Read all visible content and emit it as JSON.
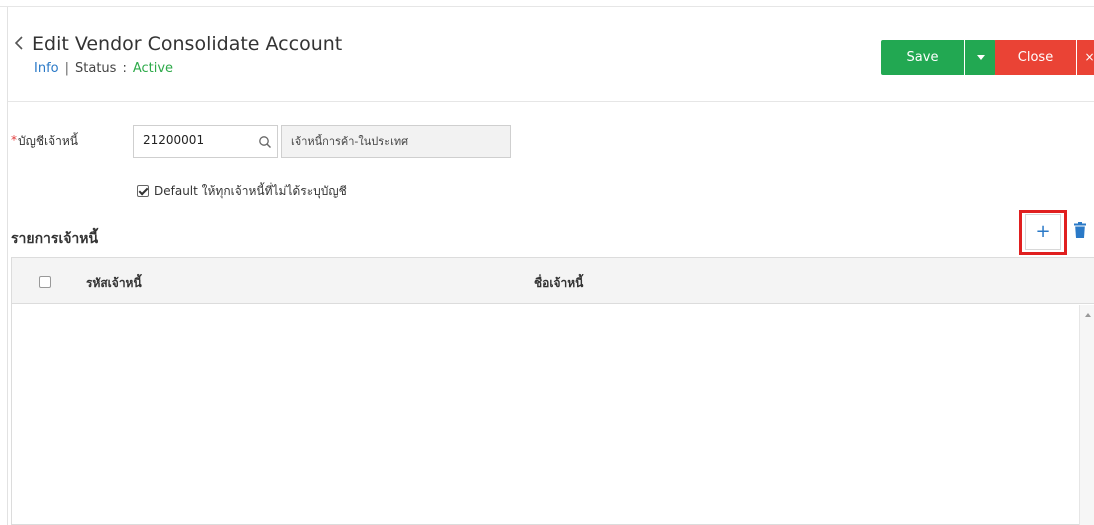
{
  "header": {
    "title": "Edit Vendor Consolidate Account",
    "info_link": "Info",
    "separator": "|",
    "status_label": "Status",
    "status_colon": ":",
    "status_value": "Active"
  },
  "toolbar": {
    "save_label": "Save",
    "close_label": "Close",
    "close_x": "×"
  },
  "form": {
    "required_mark": "*",
    "account_label": "บัญชีเจ้าหนี้",
    "account_code": "21200001",
    "account_name": "เจ้าหนี้การค้า-ในประเทศ",
    "default_checkbox_label": "Default ให้ทุกเจ้าหนี้ที่ไม่ได้ระบุบัญชี",
    "default_checked": true
  },
  "section": {
    "title": "รายการเจ้าหนี้",
    "add_label": "+"
  },
  "grid": {
    "columns": [
      "รหัสเจ้าหนี้",
      "ชื่อเจ้าหนี้"
    ],
    "rows": []
  },
  "colors": {
    "save": "#22a852",
    "close": "#ea4335",
    "link": "#2a79c7",
    "active": "#2eaa4a",
    "highlight": "#e01f1f"
  },
  "icons": {
    "back": "chevron-left-icon",
    "search": "search-icon",
    "dropdown": "caret-down-icon",
    "add": "plus-icon",
    "delete": "trash-icon"
  }
}
